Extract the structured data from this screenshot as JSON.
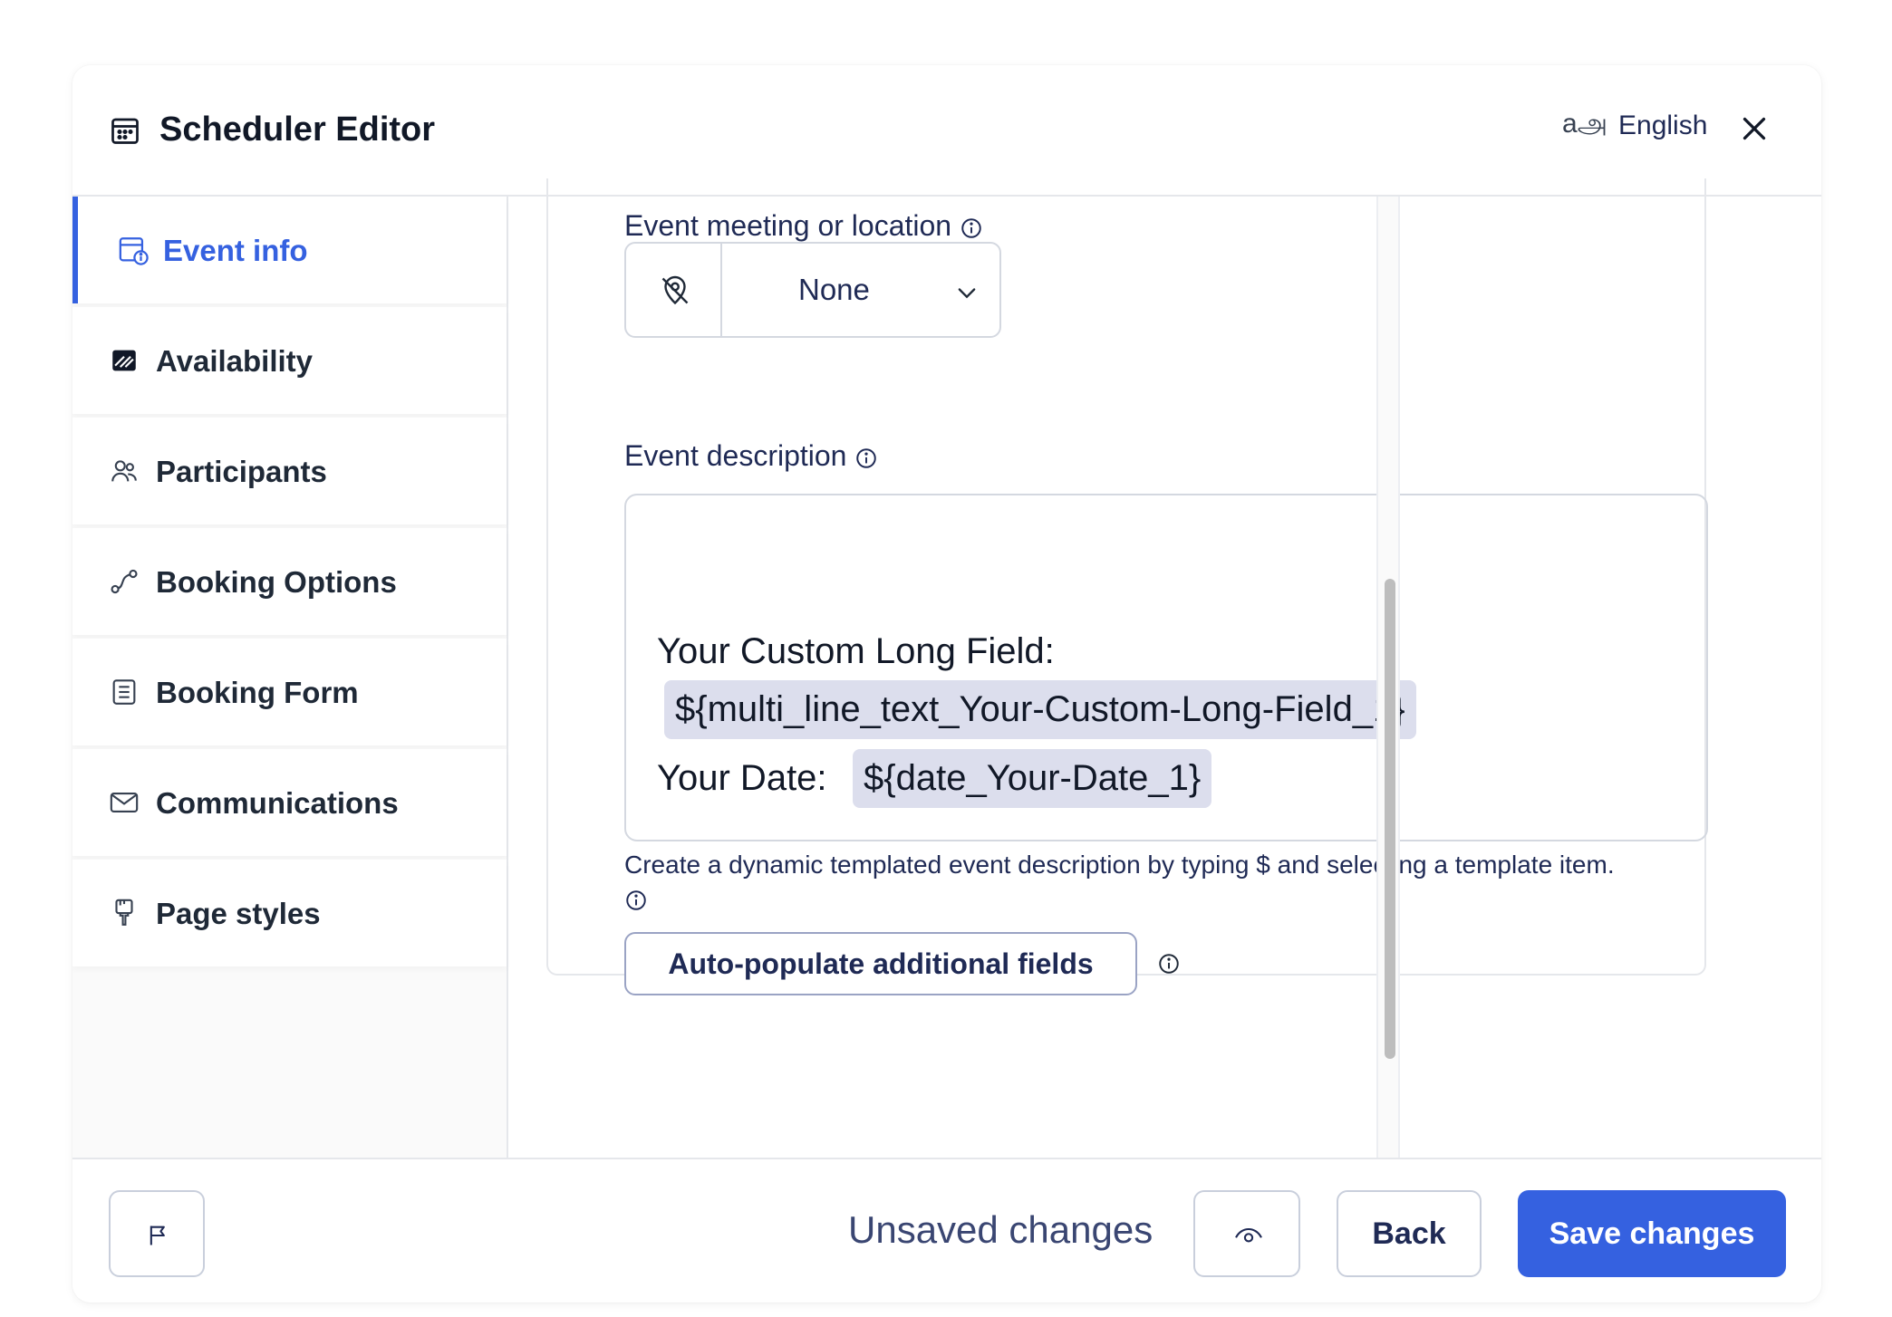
{
  "header": {
    "title": "Scheduler Editor",
    "language_icon_glyph": "அ",
    "language_prefix": "a",
    "language": "English"
  },
  "sidebar": {
    "items": [
      {
        "label": "Event info",
        "icon": "calendar-info-icon",
        "active": true
      },
      {
        "label": "Availability",
        "icon": "availability-icon"
      },
      {
        "label": "Participants",
        "icon": "participants-icon"
      },
      {
        "label": "Booking Options",
        "icon": "booking-options-icon"
      },
      {
        "label": "Booking Form",
        "icon": "form-icon"
      },
      {
        "label": "Communications",
        "icon": "envelope-icon"
      },
      {
        "label": "Page styles",
        "icon": "paintbrush-icon"
      }
    ]
  },
  "main": {
    "location_label": "Event meeting or location",
    "location_value": "None",
    "description_label": "Event description",
    "description": {
      "line1": "Your Custom Long Field:",
      "chip1": "${multi_line_text_Your-Custom-Long-Field_1}",
      "line2": "Your Date:",
      "chip2": "${date_Your-Date_1}"
    },
    "helper_text": "Create a dynamic templated event description by typing $ and selecting a template item.",
    "auto_populate_label": "Auto-populate additional fields"
  },
  "footer": {
    "status": "Unsaved changes",
    "back_label": "Back",
    "save_label": "Save changes"
  },
  "colors": {
    "accent": "#3561e0",
    "chip_bg": "#dcdeed",
    "text_dark": "#1f2a55"
  }
}
